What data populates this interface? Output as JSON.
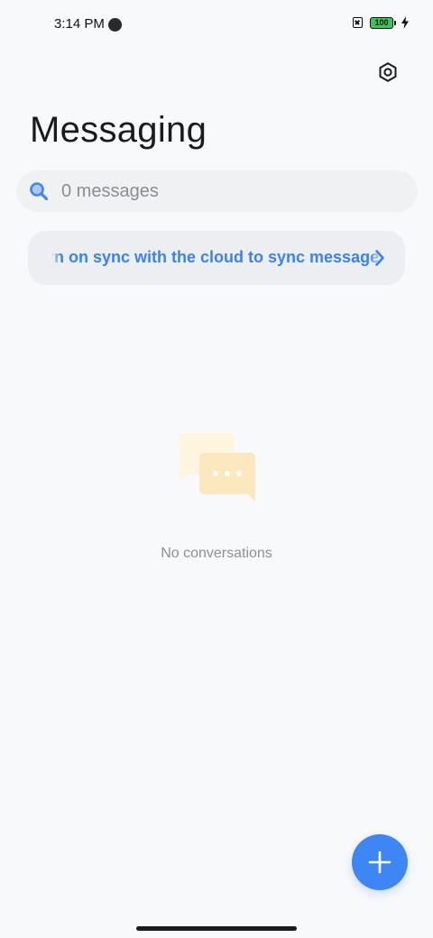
{
  "status_bar": {
    "time": "3:14 PM",
    "battery_level": "100",
    "charging": true,
    "battery_color": "#35c759"
  },
  "header": {
    "title": "Messaging",
    "settings_icon": "settings-hexagon-icon"
  },
  "search": {
    "placeholder": "0 messages",
    "value": "",
    "icon": "search-icon"
  },
  "sync_banner": {
    "text": "Turn on sync with the cloud to sync messages",
    "visible_text": "rn on sync with the cloud to sync message",
    "action_icon": "chevron-right-icon",
    "text_color": "#3b82f0"
  },
  "empty_state": {
    "illustration": "chat-bubbles-icon",
    "text": "No conversations"
  },
  "fab": {
    "icon": "plus-icon",
    "color": "#3f86f5"
  },
  "colors": {
    "accent": "#3f86f5",
    "background": "#f8f9fb"
  }
}
